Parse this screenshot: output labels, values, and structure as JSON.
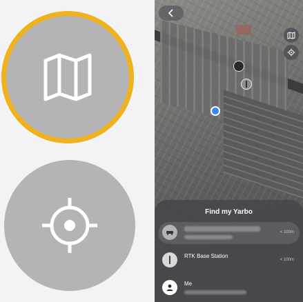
{
  "bottom_sheet": {
    "title": "Find my Yarbo",
    "items": [
      {
        "label": "",
        "distance": "< 100m",
        "icon": "mower-icon"
      },
      {
        "label": "RTK Base Station",
        "distance": "< 100m",
        "icon": "rtk-station-icon"
      },
      {
        "label": "Me",
        "distance": "",
        "icon": "person-icon"
      }
    ]
  },
  "map_controls": [
    "map-view-icon",
    "locate-icon"
  ],
  "colors": {
    "highlight_ring": "#f0b21c",
    "location_dot": "#3b82f6",
    "sheet_bg": "#46464c"
  }
}
